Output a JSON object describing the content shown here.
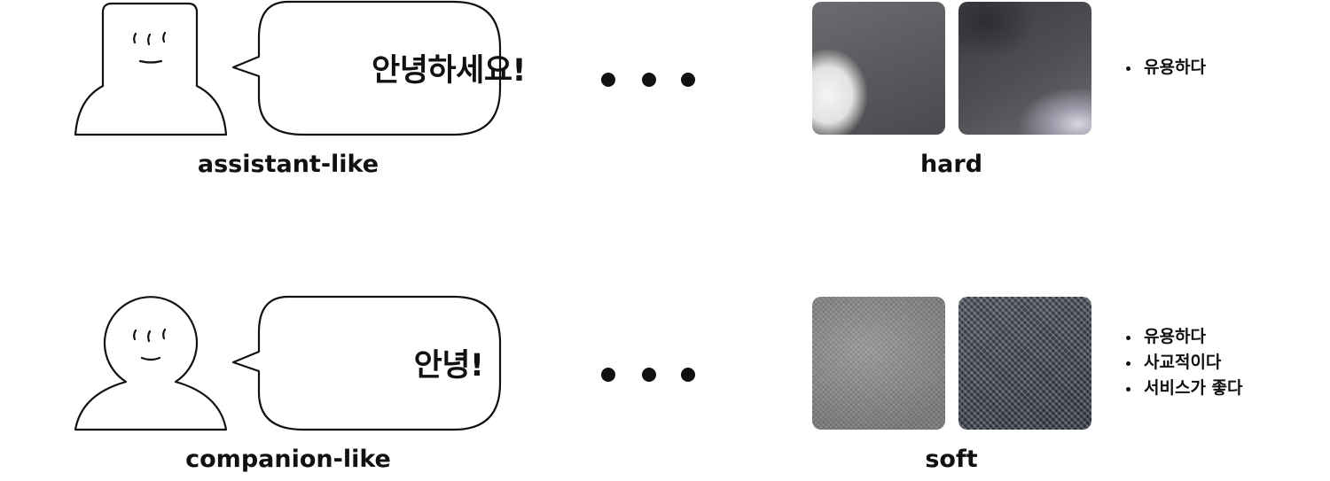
{
  "rows": [
    {
      "character": "assistant-person-icon",
      "bubble_text": "안녕하세요!",
      "character_caption": "assistant-like",
      "texture_caption": "hard",
      "traits": [
        "유용하다"
      ]
    },
    {
      "character": "companion-person-icon",
      "bubble_text": "안녕!",
      "character_caption": "companion-like",
      "texture_caption": "soft",
      "traits": [
        "유용하다",
        "사교적이다",
        "서비스가 좋다"
      ]
    }
  ],
  "colors": {
    "ink": "#111111",
    "background": "#ffffff"
  }
}
